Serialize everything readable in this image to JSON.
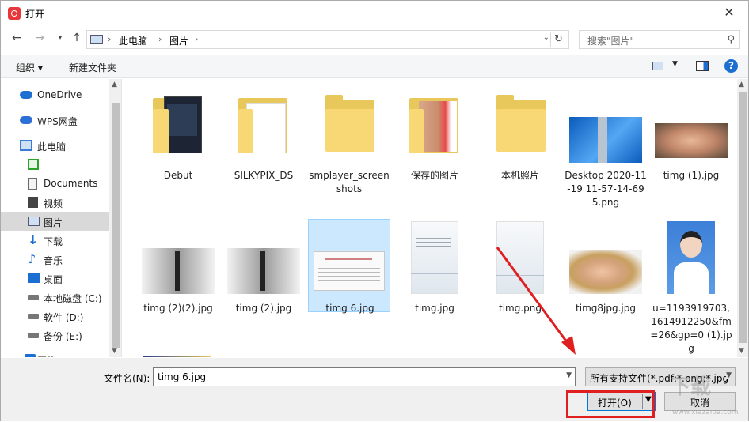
{
  "window": {
    "title": "打开",
    "close_symbol": "✕"
  },
  "address": {
    "crumbs": [
      "此电脑",
      "图片"
    ],
    "search_placeholder": "搜索\"图片\""
  },
  "toolbar": {
    "organize": "组织 ▾",
    "new_folder": "新建文件夹",
    "help": "?"
  },
  "sidebar": {
    "items": [
      {
        "label": "OneDrive",
        "icon": "cloud-icon",
        "color": "#1c6fd1"
      },
      {
        "label": "WPS网盘",
        "icon": "cloud-icon",
        "color": "#2c6fd6"
      },
      {
        "label": "此电脑",
        "icon": "computer-icon",
        "color": "#3a7bd5"
      },
      {
        "label": "",
        "icon": "green-drive-icon",
        "color": "#2aa52a"
      },
      {
        "label": "Documents",
        "icon": "document-icon",
        "color": "#6b6b6b"
      },
      {
        "label": "视频",
        "icon": "video-icon",
        "color": "#444"
      },
      {
        "label": "图片",
        "icon": "picture-icon",
        "color": "#557"
      },
      {
        "label": "下载",
        "icon": "download-icon",
        "color": "#1c6fd1"
      },
      {
        "label": "音乐",
        "icon": "music-icon",
        "color": "#1c6fd1"
      },
      {
        "label": "桌面",
        "icon": "desktop-icon",
        "color": "#1c6fd1"
      },
      {
        "label": "本地磁盘 (C:)",
        "icon": "drive-icon",
        "color": "#444"
      },
      {
        "label": "软件 (D:)",
        "icon": "drive-icon",
        "color": "#444"
      },
      {
        "label": "备份 (E:)",
        "icon": "drive-icon",
        "color": "#444"
      },
      {
        "label": "网络",
        "icon": "network-icon",
        "color": "#1c6fd1"
      }
    ]
  },
  "files": [
    {
      "name": "Debut",
      "kind": "folder-with-screenshot"
    },
    {
      "name": "SILKYPIX_DS",
      "kind": "folder-with-paper"
    },
    {
      "name": "smplayer_screenshots",
      "kind": "folder"
    },
    {
      "name": "保存的图片",
      "kind": "folder-with-face"
    },
    {
      "name": "本机照片",
      "kind": "folder"
    },
    {
      "name": "Desktop 2020-11-19 11-57-14-695.png",
      "kind": "image-desktop"
    },
    {
      "name": "timg (1).jpg",
      "kind": "image-child"
    },
    {
      "name": "timg (2)(2).jpg",
      "kind": "image-dancer"
    },
    {
      "name": "timg (2).jpg",
      "kind": "image-dancer"
    },
    {
      "name": "timg 6.jpg",
      "kind": "image-receipt"
    },
    {
      "name": "timg.jpg",
      "kind": "image-poster"
    },
    {
      "name": "timg.png",
      "kind": "image-poster"
    },
    {
      "name": "timg8jpg.jpg",
      "kind": "image-woman"
    },
    {
      "name": "u=1193919703,1614912250&fm=26&gp=0 (1).jpg",
      "kind": "image-portrait"
    }
  ],
  "bottom": {
    "filename_label": "文件名(N):",
    "filename_value": "timg 6.jpg",
    "filetype_value": "所有支持文件(*.pdf;*.png;*.jpg",
    "open_label": "打开(O)",
    "cancel_label": "取消"
  },
  "watermark": {
    "text": "下载",
    "url": "www.xiazaiba.com"
  },
  "colors": {
    "accent": "#0078d7",
    "selection": "#cce8ff",
    "annotation": "#e02020"
  }
}
